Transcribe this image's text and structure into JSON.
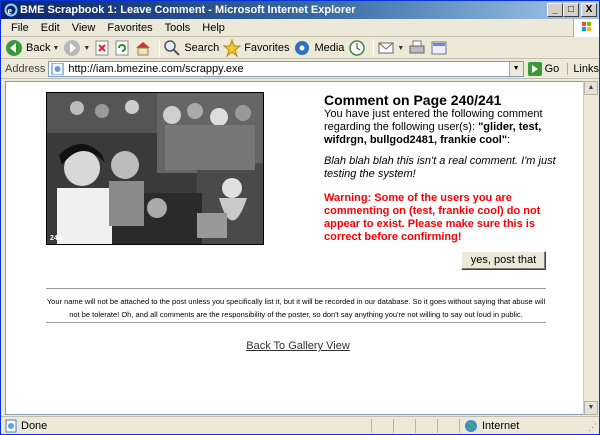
{
  "window": {
    "title": "BME Scrapbook 1: Leave Comment - Microsoft Internet Explorer",
    "minimize": "_",
    "maximize": "□",
    "close": "X"
  },
  "menu": [
    "File",
    "Edit",
    "View",
    "Favorites",
    "Tools",
    "Help"
  ],
  "toolbar": {
    "back": "Back",
    "search": "Search",
    "favorites": "Favorites",
    "media": "Media"
  },
  "address": {
    "label": "Address",
    "url": "http://iam.bmezine.com/scrappy.exe",
    "go": "Go",
    "links": "Links"
  },
  "page": {
    "photo_caption": "240",
    "heading": "Comment on Page 240/241",
    "intro_text": "You have just entered the following comment regarding the following user(s): ",
    "users": "\"glider, test, wifdrgn, bullgod2481, frankie cool\"",
    "intro_end": ":",
    "comment": "Blah blah blah this isn't a real comment. I'm just testing the system!",
    "warning": "Warning: Some of the users you are commenting on (test, frankie cool) do not appear to exist. Please make sure this is correct before confirming!",
    "post_button": "yes, post that",
    "notice": "Your name will not be attached to the post unless you specifically list it, but it will be recorded in our database. So it goes without saying that abuse will not be tolerate! Oh, and all comments are the responsibility of the poster, so don't say anything you're not willing to say out loud in public.",
    "back_link": "Back To Gallery View"
  },
  "status": {
    "done": "Done",
    "zone": "Internet"
  }
}
